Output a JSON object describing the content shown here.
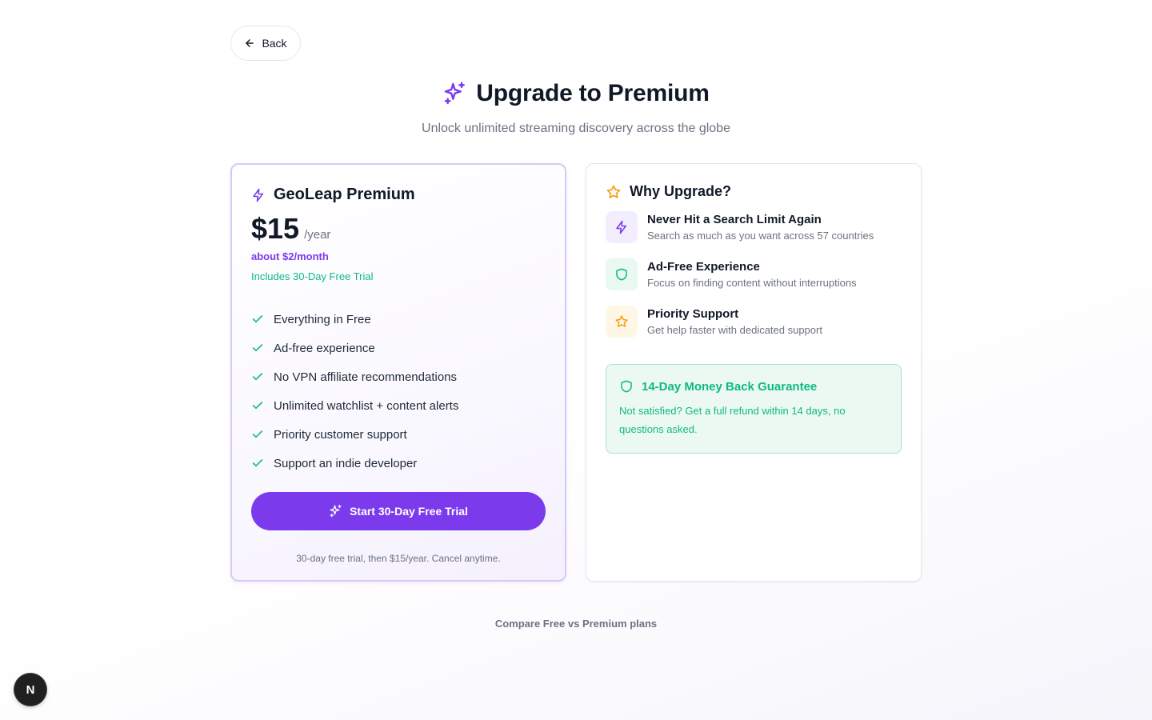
{
  "colors": {
    "accent": "#7c3aed",
    "success": "#10b981",
    "star": "#f59e0b",
    "text": "#111827",
    "muted": "#6b7280"
  },
  "nav": {
    "back_label": "Back",
    "back_icon": "arrow-left-icon"
  },
  "header": {
    "icon": "sparkles-icon",
    "title": "Upgrade to Premium",
    "subtitle": "Unlock unlimited streaming discovery across the globe"
  },
  "premium": {
    "icon": "lightning-icon",
    "name": "GeoLeap Premium",
    "price": "$15",
    "period": "/year",
    "monthly": "about $2/month",
    "trial_note": "Includes 30-Day Free Trial",
    "features": [
      "Everything in Free",
      "Ad-free experience",
      "No VPN affiliate recommendations",
      "Unlimited watchlist + content alerts",
      "Priority customer support",
      "Support an indie developer"
    ],
    "cta_label": "Start 30-Day Free Trial",
    "fineprint": "30-day free trial, then $15/year. Cancel anytime."
  },
  "why": {
    "icon": "star-icon",
    "title": "Why Upgrade?",
    "benefits": [
      {
        "icon": "lightning-icon",
        "title": "Never Hit a Search Limit Again",
        "desc": "Search as much as you want across 57 countries"
      },
      {
        "icon": "shield-icon",
        "title": "Ad-Free Experience",
        "desc": "Focus on finding content without interruptions"
      },
      {
        "icon": "star-icon",
        "title": "Priority Support",
        "desc": "Get help faster with dedicated support"
      }
    ],
    "guarantee": {
      "icon": "shield-icon",
      "title": "14-Day Money Back Guarantee",
      "desc": "Not satisfied? Get a full refund within 14 days, no questions asked."
    }
  },
  "footer": {
    "compare_label": "Compare Free vs Premium plans"
  },
  "dev_badge": {
    "label": "N"
  }
}
